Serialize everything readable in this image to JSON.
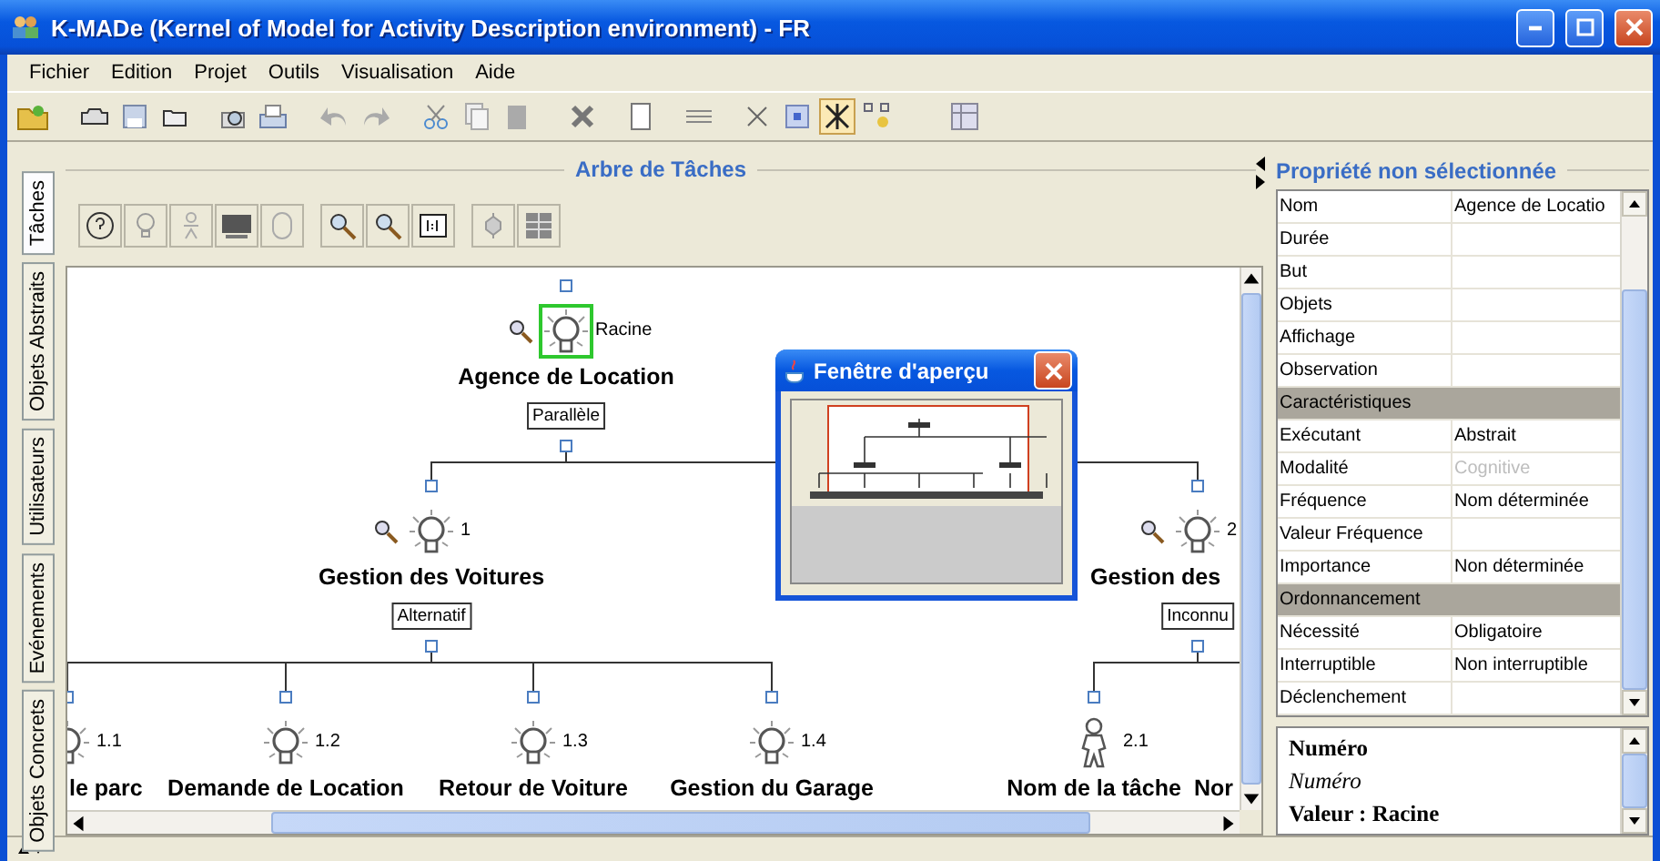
{
  "window": {
    "title": "K-MADe (Kernel of Model for Activity Description environment) - FR"
  },
  "menu": [
    "Fichier",
    "Edition",
    "Projet",
    "Outils",
    "Visualisation",
    "Aide"
  ],
  "side_tabs": [
    {
      "label": "Tâches",
      "selected": true
    },
    {
      "label": "Objets Abstraits",
      "selected": false
    },
    {
      "label": "Utilisateurs",
      "selected": false
    },
    {
      "label": "Evénements",
      "selected": false
    },
    {
      "label": "Objets Concrets",
      "selected": false
    }
  ],
  "task_tree": {
    "title": "Arbre de Tâches",
    "root": {
      "name": "Agence de Location",
      "number": "Racine",
      "operator": "Parallèle",
      "kind": "abstract",
      "selected": true,
      "children": [
        {
          "name": "Gestion des Voitures",
          "number": "1",
          "operator": "Alternatif",
          "kind": "abstract",
          "selected": false,
          "children": [
            {
              "name": "le parc",
              "number": "1.1",
              "kind": "abstract",
              "selected": false
            },
            {
              "name": "Demande de Location",
              "number": "1.2",
              "kind": "abstract",
              "selected": false
            },
            {
              "name": "Retour de Voiture",
              "number": "1.3",
              "kind": "abstract",
              "selected": false
            },
            {
              "name": "Gestion du Garage",
              "number": "1.4",
              "kind": "abstract",
              "selected": false
            }
          ]
        },
        {
          "name": "Gestion des",
          "number": "2",
          "operator": "Inconnu",
          "kind": "abstract",
          "selected": false,
          "children": [
            {
              "name": "Nom de la tâche",
              "number": "2.1",
              "kind": "user",
              "selected": false
            },
            {
              "name": "Nor"
            }
          ]
        }
      ]
    }
  },
  "preview_window": {
    "title": "Fenêtre d'aperçu"
  },
  "properties": {
    "title": "Propriété non sélectionnée",
    "rows": [
      {
        "kind": "property",
        "name": "Nom",
        "value": "Agence de Locatio",
        "disabled": false
      },
      {
        "kind": "property",
        "name": "Durée"
      },
      {
        "kind": "property",
        "name": "But"
      },
      {
        "kind": "property",
        "name": "Objets"
      },
      {
        "kind": "property",
        "name": "Affichage"
      },
      {
        "kind": "property",
        "name": "Observation"
      },
      {
        "kind": "section",
        "name": "Caractéristiques"
      },
      {
        "kind": "property",
        "name": "Exécutant",
        "value": "Abstrait",
        "disabled": false
      },
      {
        "kind": "property",
        "name": "Modalité",
        "value": "Cognitive",
        "disabled": true
      },
      {
        "kind": "property",
        "name": "Fréquence",
        "value": "Nom déterminée",
        "disabled": false
      },
      {
        "kind": "property",
        "name": "Valeur Fréquence"
      },
      {
        "kind": "property",
        "name": "Importance",
        "value": "Non déterminée",
        "disabled": false
      },
      {
        "kind": "section",
        "name": "Ordonnancement"
      },
      {
        "kind": "property",
        "name": "Nécessité",
        "value": "Obligatoire",
        "disabled": false
      },
      {
        "kind": "property",
        "name": "Interruptible",
        "value": "Non interruptible",
        "disabled": false
      },
      {
        "kind": "property",
        "name": "Déclenchement"
      }
    ],
    "description": {
      "heading": "Numéro",
      "text": "Numéro",
      "value": "Valeur : Racine"
    }
  }
}
